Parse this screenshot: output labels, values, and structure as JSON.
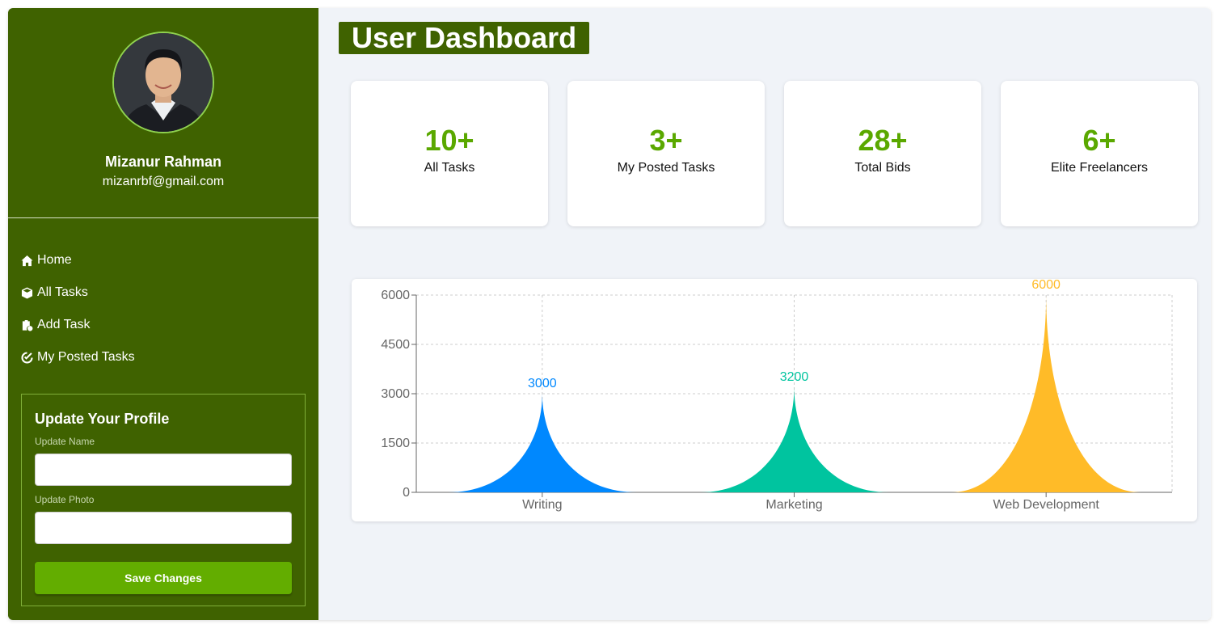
{
  "user": {
    "name": "Mizanur Rahman",
    "email": "mizanrbf@gmail.com"
  },
  "nav": {
    "items": [
      {
        "label": "Home",
        "icon": "home-icon"
      },
      {
        "label": "All Tasks",
        "icon": "cube-icon"
      },
      {
        "label": "Add Task",
        "icon": "clipboard-plus-icon"
      },
      {
        "label": "My Posted Tasks",
        "icon": "check-circle-icon"
      }
    ]
  },
  "profile_form": {
    "title": "Update Your Profile",
    "name_label": "Update Name",
    "name_value": "",
    "photo_label": "Update Photo",
    "photo_value": "",
    "save_label": "Save Changes"
  },
  "main": {
    "title": "User Dashboard",
    "stats": [
      {
        "value": "10+",
        "label": "All Tasks"
      },
      {
        "value": "3+",
        "label": "My Posted Tasks"
      },
      {
        "value": "28+",
        "label": "Total Bids"
      },
      {
        "value": "6+",
        "label": "Elite Freelancers"
      }
    ]
  },
  "colors": {
    "sidebar_bg": "#3f6200",
    "accent_green": "#5aa800",
    "button_green": "#63ad00",
    "main_bg": "#f0f3f8"
  },
  "chart_data": {
    "type": "bar",
    "categories": [
      "Writing",
      "Marketing",
      "Web Development"
    ],
    "values": [
      3000,
      3200,
      6000
    ],
    "colors": [
      "#0088fe",
      "#00c49f",
      "#ffbb28"
    ],
    "ylim": [
      0,
      6000
    ],
    "yticks": [
      0,
      1500,
      3000,
      4500,
      6000
    ],
    "grid": true,
    "data_labels": true,
    "bar_shape": "concave-triangle"
  }
}
